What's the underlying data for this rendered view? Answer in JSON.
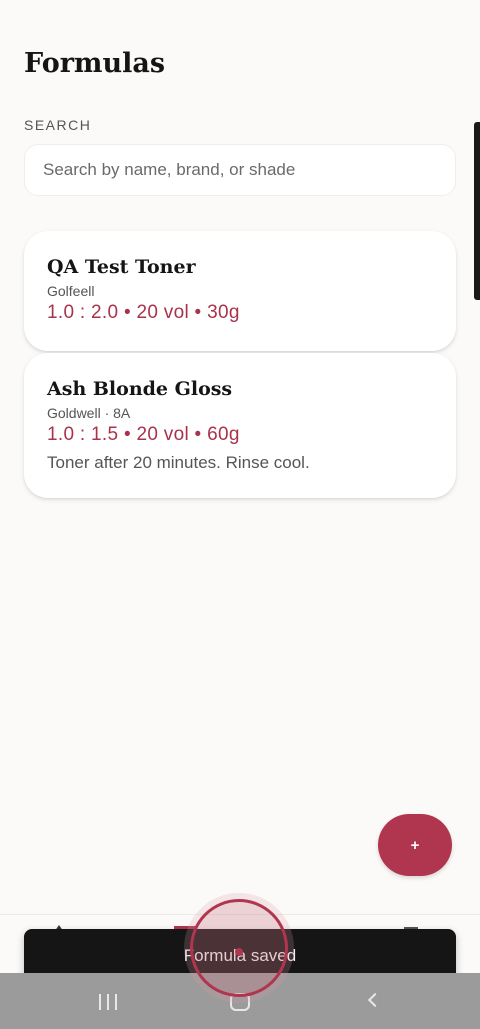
{
  "app": {
    "title": "Formulas"
  },
  "search": {
    "label": "SEARCH",
    "placeholder": "Search by name, brand, or shade",
    "value": ""
  },
  "formulas": [
    {
      "name": "QA Test Toner",
      "brand": "Golfeell",
      "ratio": "1.0 : 2.0 • 20 vol • 30g",
      "note": ""
    },
    {
      "name": "Ash Blonde Gloss",
      "brand": "Goldwell · 8A",
      "ratio": "1.0 : 1.5 • 20 vol • 60g",
      "note": "Toner after 20 minutes. Rinse cool."
    }
  ],
  "fab": {
    "label": "+"
  },
  "snackbar": {
    "message": "Formula saved"
  },
  "colors": {
    "accent": "#b0364f",
    "background": "#fbfaf8",
    "card": "#ffffff",
    "snackbar": "#151515",
    "system_nav": "#9b9b9b"
  },
  "icons": {
    "fab": "plus-icon",
    "system_recents": "recents-icon",
    "system_home": "home-icon",
    "system_back": "back-icon"
  }
}
